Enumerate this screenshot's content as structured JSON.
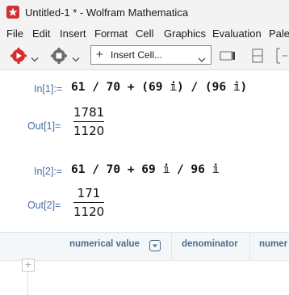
{
  "window": {
    "title": "Untitled-1 * - Wolfram Mathematica"
  },
  "menu": [
    "File",
    "Edit",
    "Insert",
    "Format",
    "Cell",
    "Graphics",
    "Evaluation",
    "Palet"
  ],
  "toolbar": {
    "insert_cell_label": "Insert Cell...",
    "icons": [
      "evaluate-icon",
      "abort-icon",
      "insert-cell-icon",
      "layout-icon",
      "panel-icon",
      "cell-bracket-icon"
    ]
  },
  "cells": [
    {
      "in_label": "In[1]:=",
      "input": "61 / 70 + (69 𝕚) / (96 𝕚)",
      "out_label": "Out[1]=",
      "output": {
        "numerator": "1781",
        "denominator": "1120"
      }
    },
    {
      "in_label": "In[2]:=",
      "input": "61 / 70 + 69 𝕚 / 96 𝕚",
      "out_label": "Out[2]=",
      "output": {
        "numerator": "171",
        "denominator": "1120"
      }
    }
  ],
  "suggestions": [
    "numerical value",
    "denominator",
    "numer"
  ],
  "colors": {
    "label": "#4a6fa5",
    "suggestion": "#4d6a86",
    "logo": "#d32f2f"
  }
}
